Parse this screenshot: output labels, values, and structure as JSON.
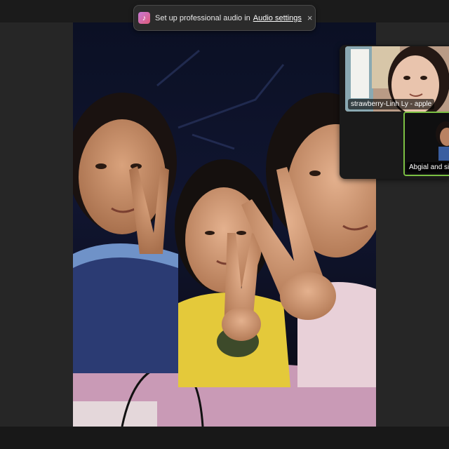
{
  "notification": {
    "text": "Set up professional audio in",
    "link_label": "Audio settings",
    "close_label": "×",
    "icon": "music-note-icon"
  },
  "main_video": {
    "description_icon": "video-feed"
  },
  "participants": [
    {
      "name": "strawberry-Linh Ly - apple",
      "active_speaker": false
    },
    {
      "name": "Abgial and sis",
      "active_speaker": true
    }
  ],
  "colors": {
    "active_speaker_border": "#7bc043",
    "toast_background": "#2b2b2b",
    "app_background": "#202020"
  }
}
